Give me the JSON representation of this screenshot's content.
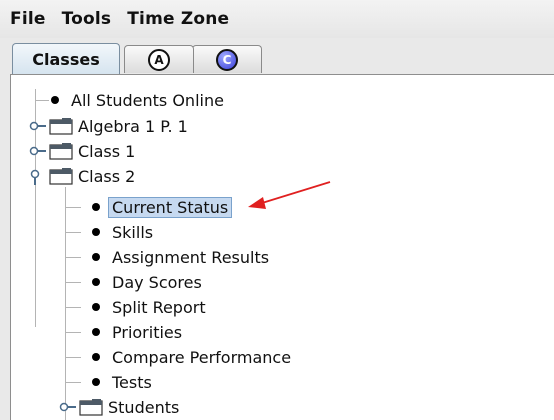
{
  "menubar": {
    "items": [
      "File",
      "Tools",
      "Time Zone"
    ]
  },
  "tabs": {
    "classes_label": "Classes",
    "a_glyph": "A",
    "c_glyph": "C"
  },
  "tree": {
    "root_label": "All Students Online",
    "folders": [
      {
        "label": "Algebra 1 P. 1",
        "expanded": false
      },
      {
        "label": "Class 1",
        "expanded": false
      },
      {
        "label": "Class 2",
        "expanded": true
      }
    ],
    "class2_children": [
      {
        "label": "Current Status",
        "selected": true
      },
      {
        "label": "Skills"
      },
      {
        "label": "Assignment Results"
      },
      {
        "label": "Day Scores"
      },
      {
        "label": "Split Report"
      },
      {
        "label": "Priorities"
      },
      {
        "label": "Compare Performance"
      },
      {
        "label": "Tests"
      }
    ],
    "students_folder": {
      "label": "Students",
      "expanded": false
    }
  },
  "colors": {
    "selection_bg": "#c6d9f0",
    "annotation_arrow": "#e02020",
    "c_badge": "#3a3fd8"
  },
  "icons": [
    "folder-icon",
    "expand-handle-icon",
    "collapse-handle-icon",
    "bullet-icon",
    "a-badge-icon",
    "c-badge-icon",
    "annotation-arrow-icon"
  ]
}
